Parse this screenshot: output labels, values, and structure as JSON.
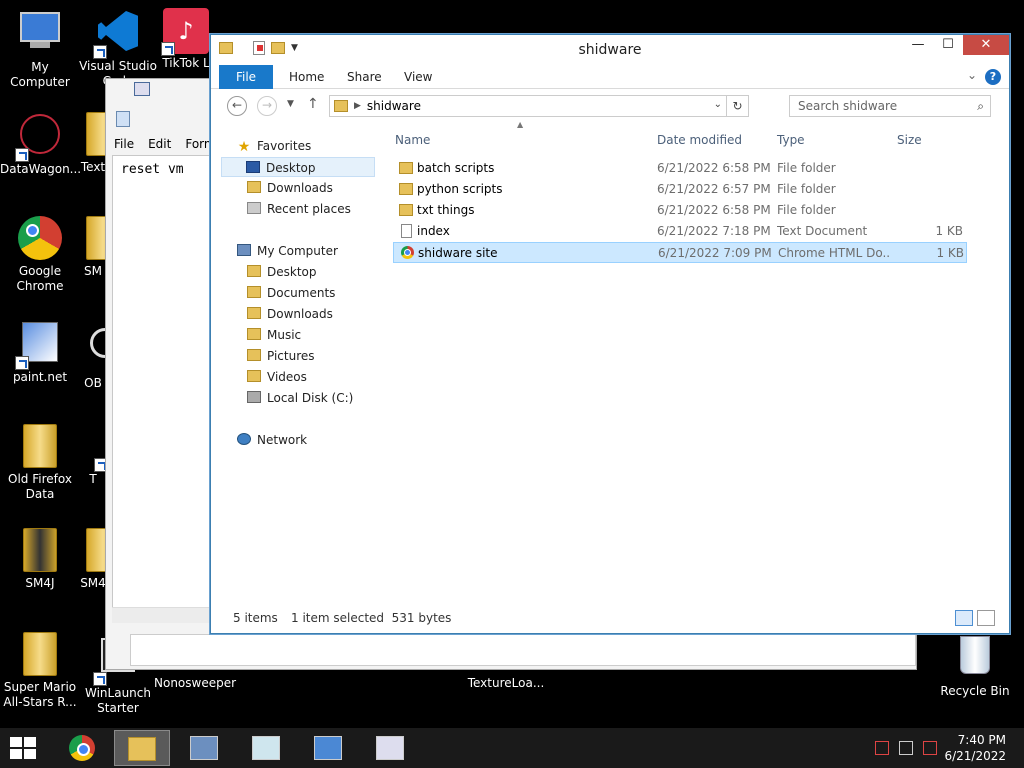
{
  "desktop": {
    "icons": [
      {
        "label": "My Computer"
      },
      {
        "label": "Visual Studio Code"
      },
      {
        "label": "TikTok L"
      },
      {
        "label": "DataWagon..."
      },
      {
        "label": "Text"
      },
      {
        "label": "Google Chrome"
      },
      {
        "label": "SM"
      },
      {
        "label": "paint.net"
      },
      {
        "label": "OB"
      },
      {
        "label": "Old Firefox Data"
      },
      {
        "label": "T"
      },
      {
        "label": "SM4J"
      },
      {
        "label": "SM4"
      },
      {
        "label": "Super Mario All-Stars R..."
      },
      {
        "label": "WinLaunch Starter"
      },
      {
        "label": "Nonosweeper"
      },
      {
        "label": "TextureLoa..."
      },
      {
        "label": "Recycle Bin"
      }
    ]
  },
  "notepad": {
    "menu": [
      "File",
      "Edit",
      "Form"
    ],
    "content": "reset vm"
  },
  "explorer": {
    "title": "shidware",
    "ribbon_tabs": [
      "File",
      "Home",
      "Share",
      "View"
    ],
    "help": "?",
    "address": {
      "crumb": "shidware"
    },
    "search": {
      "placeholder": "Search shidware"
    },
    "nav": {
      "favorites": "Favorites",
      "favorites_items": [
        "Desktop",
        "Downloads",
        "Recent places"
      ],
      "computer": "My Computer",
      "computer_items": [
        "Desktop",
        "Documents",
        "Downloads",
        "Music",
        "Pictures",
        "Videos",
        "Local Disk (C:)"
      ],
      "network": "Network"
    },
    "columns": {
      "name": "Name",
      "date": "Date modified",
      "type": "Type",
      "size": "Size"
    },
    "files": [
      {
        "name": "batch scripts",
        "date": "6/21/2022 6:58 PM",
        "type": "File folder",
        "size": ""
      },
      {
        "name": "python scripts",
        "date": "6/21/2022 6:57 PM",
        "type": "File folder",
        "size": ""
      },
      {
        "name": "txt things",
        "date": "6/21/2022 6:58 PM",
        "type": "File folder",
        "size": ""
      },
      {
        "name": "index",
        "date": "6/21/2022 7:18 PM",
        "type": "Text Document",
        "size": "1 KB"
      },
      {
        "name": "shidware site",
        "date": "6/21/2022 7:09 PM",
        "type": "Chrome HTML Do...",
        "size": "1 KB"
      }
    ],
    "status": {
      "count": "5 items",
      "selection": "1 item selected  531 bytes"
    }
  },
  "taskbar": {
    "time": "7:40 PM",
    "date": "6/21/2022"
  }
}
